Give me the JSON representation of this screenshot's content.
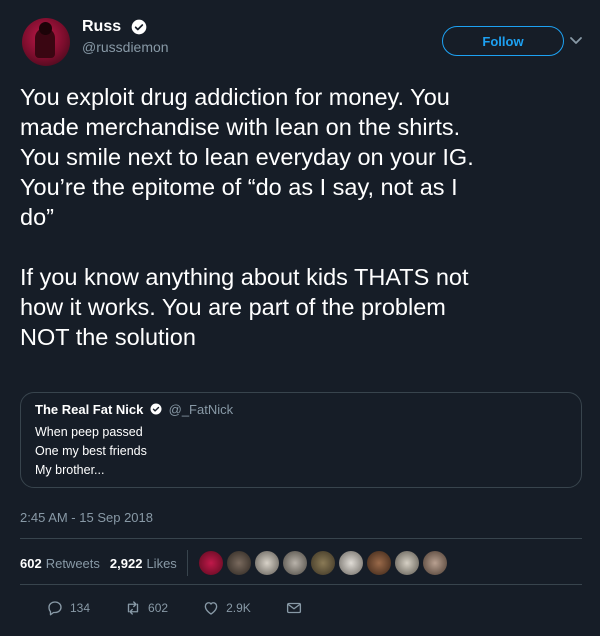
{
  "tweet": {
    "author": {
      "name": "Russ",
      "handle": "@russdiemon"
    },
    "follow_label": "Follow",
    "text": "You exploit drug addiction for money. You\nmade merchandise with lean on the shirts.\nYou smile next to lean everyday on your IG.\nYou’re the epitome of “do as I say, not as I\ndo”\n\nIf you know anything about kids THATS not\nhow it works. You are part of the problem\nNOT the solution",
    "quoted": {
      "name": "The Real Fat Nick",
      "handle": "@_FatNick",
      "text": "When peep passed\nOne my best friends\nMy brother..."
    },
    "timestamp": "2:45 AM - 15 Sep 2018",
    "stats": {
      "retweets_count": "602",
      "retweets_label": "Retweets",
      "likes_count": "2,922",
      "likes_label": "Likes"
    },
    "actions": {
      "reply_count": "134",
      "retweet_count": "602",
      "like_count": "2.9K"
    }
  },
  "colors": {
    "background": "#161d27",
    "accent": "#1da1f2",
    "muted": "#8899a6",
    "border": "#38444d"
  }
}
